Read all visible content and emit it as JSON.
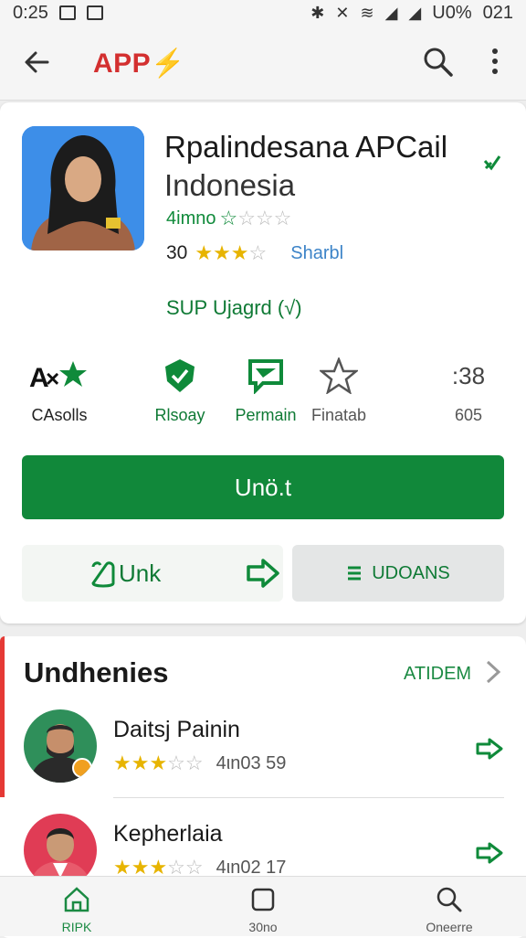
{
  "status_bar": {
    "time": "0:25",
    "battery": "U0%",
    "extra": "021"
  },
  "app_bar": {
    "title": "APP⚡"
  },
  "app": {
    "name_line1": "Rpalindesana APCail",
    "name_line2": "Indonesia",
    "developer": "4imno",
    "rating_value": "30",
    "rating_link": "Sharbl",
    "update_note": "SUP Ujaɡrd (√)"
  },
  "stats": [
    {
      "icon": "app-star-icon",
      "label": "CAsolls"
    },
    {
      "icon": "shield-check-icon",
      "label": "Rlsoay"
    },
    {
      "icon": "message-icon",
      "label": "Permain"
    },
    {
      "icon": "star-outline-icon",
      "label": "Finatab"
    },
    {
      "value": ":38",
      "label": "605"
    }
  ],
  "install_button": {
    "label": "Unö.t"
  },
  "link_button": {
    "label": "Unk"
  },
  "updates_button": {
    "label": "UDOANS"
  },
  "reviews": {
    "title": "Undhenies",
    "more": "ATIDEM",
    "items": [
      {
        "name": "Daitsj Painin",
        "meta": "4ιn03 59"
      },
      {
        "name": "Kepherlaia",
        "meta": "4ιn02 17"
      }
    ]
  },
  "bottom_nav": [
    {
      "label": "RIPK",
      "icon": "home-icon"
    },
    {
      "label": "30no",
      "icon": "square-icon"
    },
    {
      "label": "Oneerre",
      "icon": "search-icon"
    }
  ],
  "colors": {
    "accent_green": "#11883a",
    "title_red": "#d32f2f",
    "star_gold": "#e7b400"
  }
}
